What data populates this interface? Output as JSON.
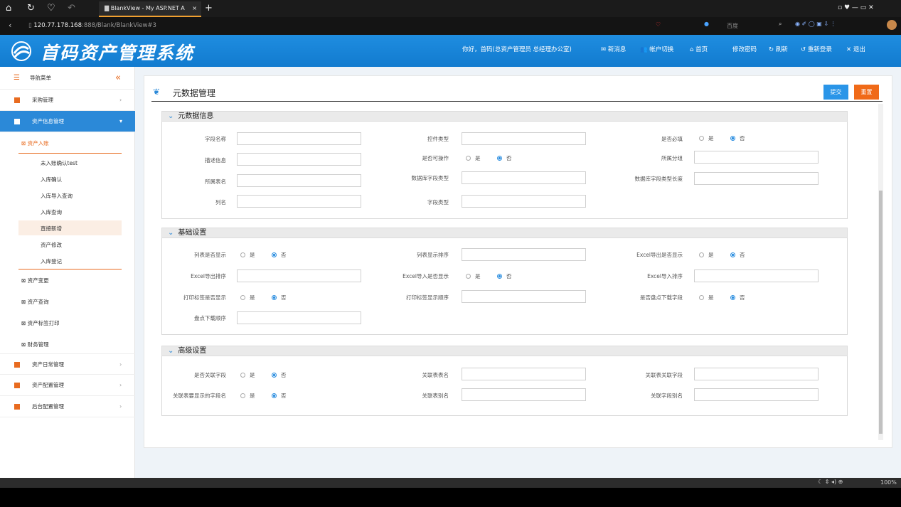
{
  "browser": {
    "tab_title": "BlankView - My ASP.NET A",
    "address_host": "120.77.178.168",
    "address_rest": ":888/Blank/BlankView#3",
    "search_engine": "百度",
    "zoom": "100%"
  },
  "header": {
    "brand": "首码资产管理系统",
    "greeting": "你好，首码(总资产管理员 总经理办公室)",
    "actions": [
      "新消息",
      "帐户切换",
      "首页",
      "修改密码",
      "刷新",
      "重新登录",
      "退出"
    ]
  },
  "sidebar": {
    "title": "导航菜单",
    "collapse": "«",
    "groups": [
      "采购管理",
      "资产信息管理",
      "资产日常管理",
      "资产配置管理",
      "后台配置管理"
    ],
    "active_sub": "资产入账",
    "sub_items": [
      "未入账确认test",
      "入库确认",
      "入库导入查询",
      "入库查询",
      "直接新增",
      "资产修改",
      "入库登记"
    ],
    "other_subs": [
      "资产变更",
      "资产查询",
      "资产标签打印",
      "财务管理"
    ]
  },
  "page": {
    "title": "元数据管理",
    "submit": "提交",
    "reset": "重置"
  },
  "sections": {
    "meta": {
      "title": "元数据信息",
      "f1": "字段名称",
      "f2": "控件类型",
      "f3": "是否必填",
      "f4": "描述信息",
      "f5": "是否可操作",
      "f6": "所属分组",
      "f7": "所属表名",
      "f8": "数据库字段类型",
      "f9": "数据库字段类型长度",
      "f10": "列名",
      "f11": "字段类型"
    },
    "basic": {
      "title": "基础设置",
      "f1": "列表是否显示",
      "f2": "列表显示排序",
      "f3": "Excel导出是否显示",
      "f4": "Excel导出排序",
      "f5": "Excel导入是否显示",
      "f6": "Excel导入排序",
      "f7": "打印标签是否显示",
      "f8": "打印标签显示顺序",
      "f9": "是否盘点下载字段",
      "f10": "盘点下载顺序"
    },
    "advanced": {
      "title": "高级设置",
      "f1": "是否关联字段",
      "f2": "关联表表名",
      "f3": "关联表关联字段",
      "f4": "关联表要显示的字段名",
      "f5": "关联表别名",
      "f6": "关联字段别名"
    }
  },
  "radio": {
    "yes": "是",
    "no": "否"
  },
  "colors": {
    "header": "#1a86da",
    "accent_orange": "#f06a18",
    "submit_blue": "#2a95e8"
  }
}
